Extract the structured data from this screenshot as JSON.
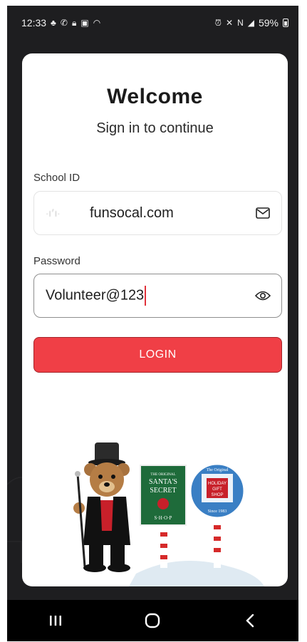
{
  "status_bar": {
    "time": "12:33",
    "battery_percent": "59%",
    "left_icons": [
      "notification-icon",
      "wifi-calling-icon",
      "lock-icon",
      "gallery-icon",
      "wifi-icon"
    ],
    "right_icons": [
      "alarm-icon",
      "mute-icon",
      "nfc-icon",
      "signal-icon",
      "battery-icon"
    ]
  },
  "login": {
    "title": "Welcome",
    "subtitle": "Sign in to continue",
    "school_id_label": "School ID",
    "school_id_value": "funsocal.com",
    "password_label": "Password",
    "password_value": "Volunteer@123",
    "email_icon": "envelope-icon",
    "visibility_icon": "eye-icon",
    "login_button": "LOGIN"
  },
  "illustration": {
    "sign_left_lines": [
      "THE ORIGINAL",
      "SANTA'S",
      "SECRET",
      "S·H·O·P"
    ],
    "sign_right_lines": [
      "The Original",
      "HOLIDAY",
      "GIFT",
      "SHOP",
      "Since 1983"
    ]
  },
  "nav_bar": {
    "icons": [
      "recents-icon",
      "home-icon",
      "back-icon"
    ]
  },
  "colors": {
    "accent": "#f03f46",
    "background": "#1e1e20",
    "card": "#ffffff"
  }
}
